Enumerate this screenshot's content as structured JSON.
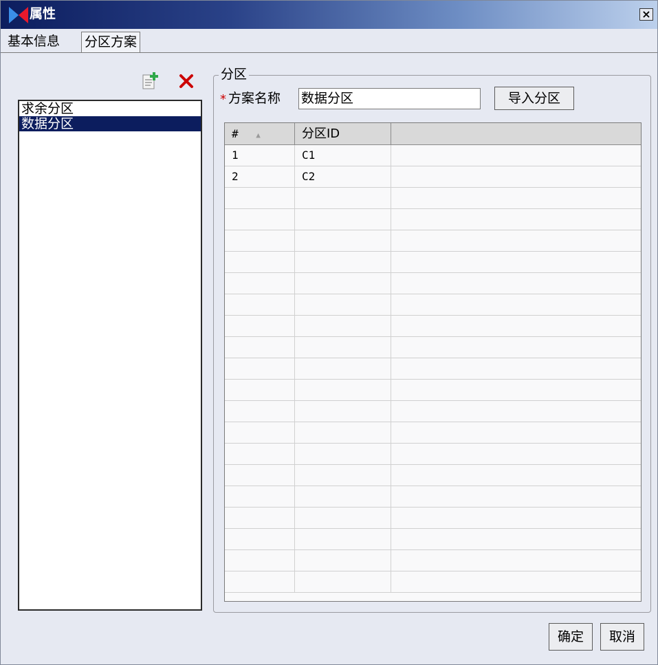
{
  "window": {
    "title": "属性",
    "close_label": "×"
  },
  "tabs": [
    {
      "label": "基本信息"
    },
    {
      "label": "分区方案"
    }
  ],
  "toolbar": {
    "add_icon": "add-document-icon",
    "delete_icon": "delete-x-icon"
  },
  "scheme_list": {
    "items": [
      {
        "label": "求余分区"
      },
      {
        "label": "数据分区"
      }
    ],
    "selected": "数据分区"
  },
  "partition_group": {
    "legend": "分区",
    "required_mark": "*",
    "name_label": "方案名称",
    "name_value": "数据分区",
    "import_button": "导入分区"
  },
  "grid": {
    "columns": [
      "#",
      "分区ID",
      ""
    ],
    "sort_icon": "sort-ascending-icon",
    "rows": [
      {
        "num": "1",
        "id": "C1",
        "extra": ""
      },
      {
        "num": "2",
        "id": "C2",
        "extra": ""
      }
    ]
  },
  "buttons": {
    "ok": "确定",
    "cancel": "取消"
  },
  "colors": {
    "titlebar_dark": "#0c1d5e",
    "selection": "#0c1d5e",
    "dialog_bg": "#e6e9f2",
    "delete_red": "#cc0000"
  }
}
